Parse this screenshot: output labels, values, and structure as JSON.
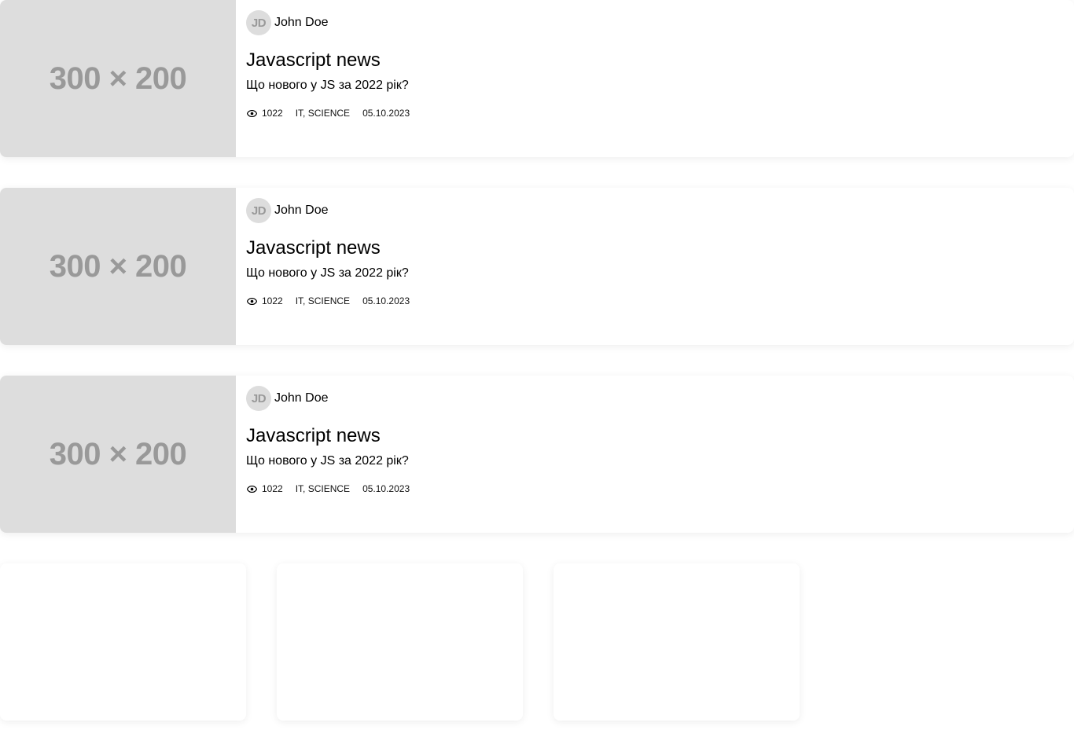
{
  "articles": [
    {
      "image_placeholder": "300 × 200",
      "author": {
        "initials": "JD",
        "name": "John Doe"
      },
      "title": "Javascript news",
      "subtitle": "Що нового у JS за 2022 рік?",
      "views": "1022",
      "tags": "IT, SCIENCE",
      "date": "05.10.2023"
    },
    {
      "image_placeholder": "300 × 200",
      "author": {
        "initials": "JD",
        "name": "John Doe"
      },
      "title": "Javascript news",
      "subtitle": "Що нового у JS за 2022 рік?",
      "views": "1022",
      "tags": "IT, SCIENCE",
      "date": "05.10.2023"
    },
    {
      "image_placeholder": "300 × 200",
      "author": {
        "initials": "JD",
        "name": "John Doe"
      },
      "title": "Javascript news",
      "subtitle": "Що нового у JS за 2022 рік?",
      "views": "1022",
      "tags": "IT, SCIENCE",
      "date": "05.10.2023"
    }
  ],
  "icons": {
    "views": "eye-icon"
  },
  "colors": {
    "placeholder_bg": "#dddddd",
    "placeholder_text": "#999999"
  }
}
